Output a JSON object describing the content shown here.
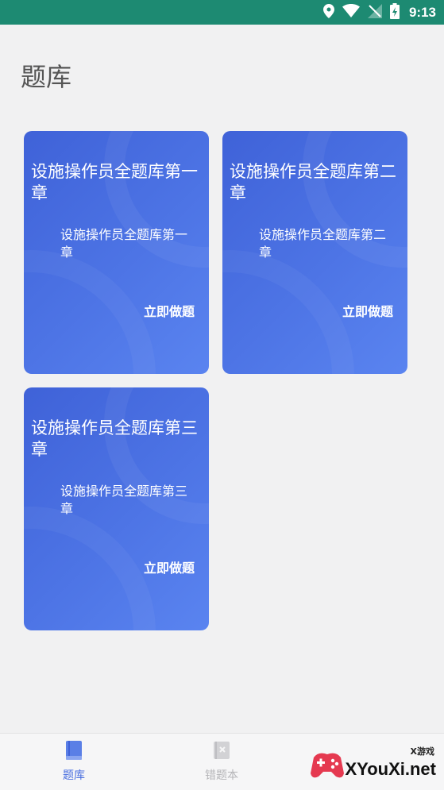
{
  "status_bar": {
    "time": "9:13",
    "icons": [
      "location-icon",
      "wifi-icon",
      "signal-icon",
      "battery-icon"
    ]
  },
  "page": {
    "title": "题库"
  },
  "cards": [
    {
      "title": "设施操作员全题库第一章",
      "description": "设施操作员全题库第一章",
      "action": "立即做题"
    },
    {
      "title": "设施操作员全题库第二章",
      "description": "设施操作员全题库第二章",
      "action": "立即做题"
    },
    {
      "title": "设施操作员全题库第三章",
      "description": "设施操作员全题库第三章",
      "action": "立即做题"
    }
  ],
  "bottom_nav": {
    "items": [
      {
        "label": "题库",
        "icon": "book-icon",
        "active": true
      },
      {
        "label": "错题本",
        "icon": "wrong-book-icon",
        "active": false
      }
    ]
  },
  "watermark": {
    "small": "X游戏",
    "big": "XYouXi.net"
  },
  "colors": {
    "status_bar": "#1d8a72",
    "card_gradient_start": "#3f62d8",
    "card_gradient_end": "#5a84f0",
    "nav_active": "#4a6fe0",
    "nav_inactive": "#b5b5b8"
  }
}
